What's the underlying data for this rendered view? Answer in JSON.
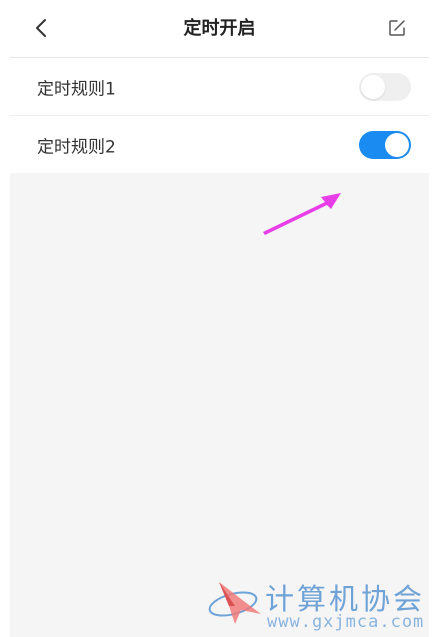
{
  "header": {
    "title": "定时开启",
    "back_icon": "chevron-left-icon",
    "edit_icon": "edit-icon"
  },
  "rules": [
    {
      "label": "定时规则1",
      "enabled": false
    },
    {
      "label": "定时规则2",
      "enabled": true
    }
  ],
  "colors": {
    "toggle_on": "#1a8bf0",
    "toggle_off": "#efefef",
    "annotation_arrow": "#e83ee8",
    "background": "#f5f5f5"
  },
  "watermark": {
    "title": "计算机协会",
    "url": "www.gxjmca.com"
  }
}
